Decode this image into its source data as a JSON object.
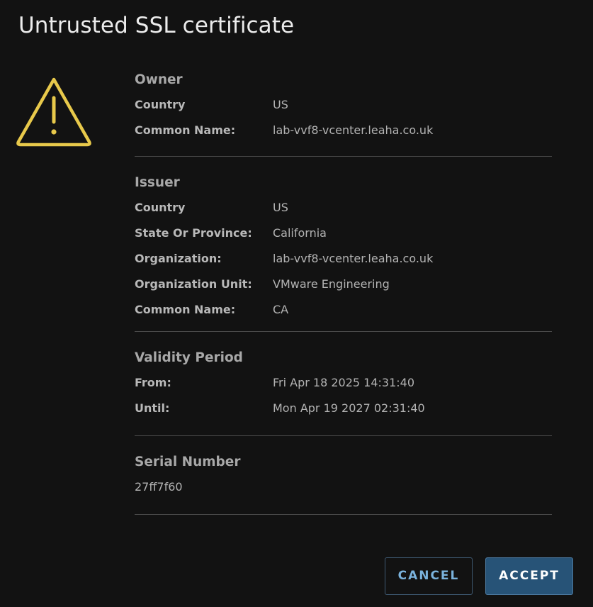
{
  "dialog": {
    "title": "Untrusted SSL certificate",
    "warning_icon": "warning-triangle-icon",
    "accent_color": "#e8c94b"
  },
  "owner": {
    "heading": "Owner",
    "rows": [
      {
        "label": "Country",
        "value": "US"
      },
      {
        "label": "Common Name:",
        "value": "lab-vvf8-vcenter.leaha.co.uk"
      }
    ]
  },
  "issuer": {
    "heading": "Issuer",
    "rows": [
      {
        "label": "Country",
        "value": "US"
      },
      {
        "label": "State Or Province:",
        "value": "California"
      },
      {
        "label": "Organization:",
        "value": "lab-vvf8-vcenter.leaha.co.uk"
      },
      {
        "label": "Organization Unit:",
        "value": "VMware Engineering"
      },
      {
        "label": "Common Name:",
        "value": "CA"
      }
    ]
  },
  "validity": {
    "heading": "Validity Period",
    "rows": [
      {
        "label": "From:",
        "value": "Fri Apr 18 2025 14:31:40"
      },
      {
        "label": "Until:",
        "value": "Mon Apr 19 2027 02:31:40"
      }
    ]
  },
  "serial": {
    "heading": "Serial Number",
    "value": "27ff7f60"
  },
  "buttons": {
    "cancel": "CANCEL",
    "accept": "ACCEPT"
  }
}
